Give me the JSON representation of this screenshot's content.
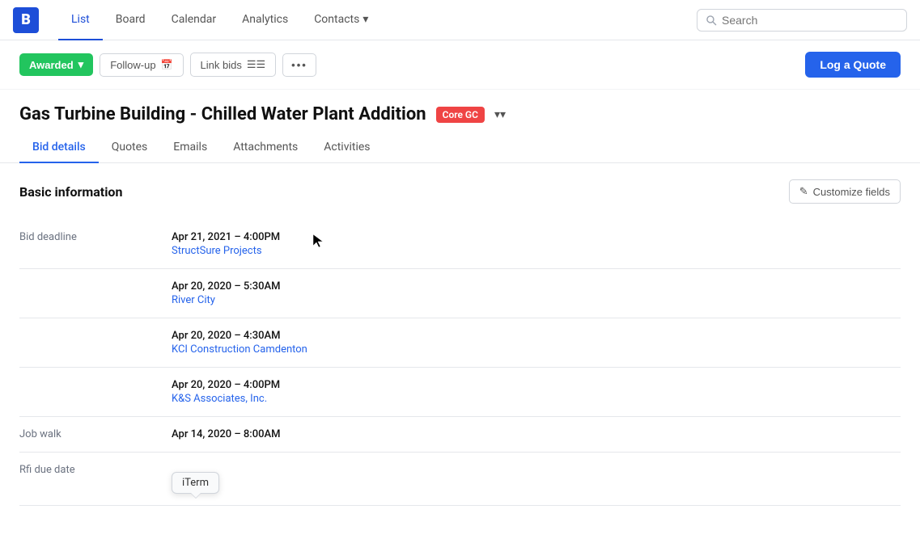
{
  "app": {
    "logo": "B"
  },
  "nav": {
    "links": [
      {
        "id": "list",
        "label": "List",
        "active": true
      },
      {
        "id": "board",
        "label": "Board",
        "active": false
      },
      {
        "id": "calendar",
        "label": "Calendar",
        "active": false
      },
      {
        "id": "analytics",
        "label": "Analytics",
        "active": false
      },
      {
        "id": "contacts",
        "label": "Contacts",
        "active": false
      }
    ],
    "search_placeholder": "Search"
  },
  "toolbar": {
    "awarded_label": "Awarded",
    "follow_up_label": "Follow-up",
    "link_bids_label": "Link bids",
    "log_quote_label": "Log a Quote"
  },
  "project": {
    "title": "Gas Turbine Building - Chilled Water Plant Addition",
    "badge": "Core GC"
  },
  "tabs": [
    {
      "id": "bid-details",
      "label": "Bid details",
      "active": true
    },
    {
      "id": "quotes",
      "label": "Quotes",
      "active": false
    },
    {
      "id": "emails",
      "label": "Emails",
      "active": false
    },
    {
      "id": "attachments",
      "label": "Attachments",
      "active": false
    },
    {
      "id": "activities",
      "label": "Activities",
      "active": false
    }
  ],
  "basic_info": {
    "title": "Basic information",
    "customize_label": "Customize fields",
    "bid_deadline_label": "Bid deadline",
    "job_walk_label": "Job walk",
    "rfi_due_date_label": "Rfi due date",
    "entries": [
      {
        "date": "Apr 21, 2021 – 4:00PM",
        "company": "StructSure Projects"
      },
      {
        "date": "Apr 20, 2020 – 5:30AM",
        "company": "River City"
      },
      {
        "date": "Apr 20, 2020 – 4:30AM",
        "company": "KCI Construction Camdenton"
      },
      {
        "date": "Apr 20, 2020 – 4:00PM",
        "company": "K&S Associates, Inc."
      }
    ],
    "job_walk_date": "Apr 14, 2020 – 8:00AM"
  },
  "tooltip": {
    "label": "iTerm"
  }
}
